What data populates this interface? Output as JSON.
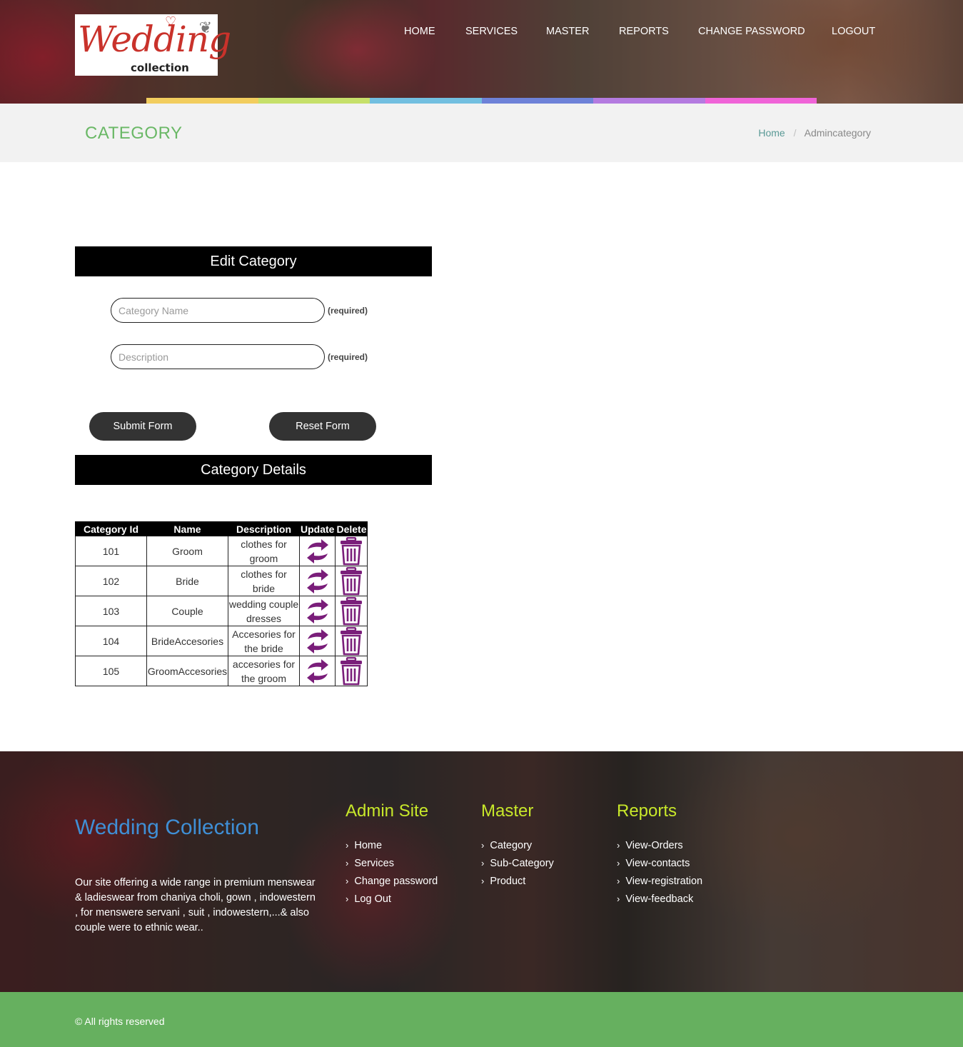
{
  "header": {
    "logo": {
      "script": "Wedding",
      "sub": "collection"
    },
    "nav": [
      "HOME",
      "SERVICES",
      "MASTER",
      "REPORTS",
      "CHANGE PASSWORD",
      "LOGOUT"
    ],
    "strip_colors": [
      "#f2cd5e",
      "#c6e06a",
      "#72bfe0",
      "#6e82d8",
      "#b47be0",
      "#f064d8"
    ]
  },
  "title_band": {
    "title": "CATEGORY",
    "breadcrumb": {
      "home": "Home",
      "separator": "/",
      "current": "Admincategory"
    }
  },
  "form": {
    "heading": "Edit Category",
    "category_name": {
      "value": "",
      "placeholder": "Category Name",
      "note": "(required)"
    },
    "description": {
      "value": "",
      "placeholder": "Description",
      "note": "(required)"
    },
    "submit_label": "Submit Form",
    "reset_label": "Reset Form"
  },
  "details": {
    "heading": "Category Details",
    "columns": [
      "Category Id",
      "Name",
      "Description",
      "Update",
      "Delete"
    ],
    "rows": [
      {
        "id": "101",
        "name": "Groom",
        "description": "clothes for groom"
      },
      {
        "id": "102",
        "name": "Bride",
        "description": "clothes for bride"
      },
      {
        "id": "103",
        "name": "Couple",
        "description": "wedding couple dresses"
      },
      {
        "id": "104",
        "name": "BrideAccesories",
        "description": "Accesories for the bride"
      },
      {
        "id": "105",
        "name": "GroomAccesories",
        "description": "accesories for the groom"
      }
    ],
    "icon_color": "#7a1e7a"
  },
  "footer": {
    "brand": "Wedding Collection",
    "about": "Our site offering a wide range in premium menswear & ladieswear from chaniya choli, gown , indowestern , for menswere servani , suit , indowestern,...& also couple were to ethnic wear..",
    "columns": [
      {
        "title": "Admin Site",
        "links": [
          "Home",
          "Services",
          "Change password",
          "Log Out"
        ]
      },
      {
        "title": "Master",
        "links": [
          "Category",
          "Sub-Category",
          "Product"
        ]
      },
      {
        "title": "Reports",
        "links": [
          "View-Orders",
          "View-contacts",
          "View-registration",
          "View-feedback"
        ]
      }
    ],
    "copyright": "© All rights reserved"
  }
}
